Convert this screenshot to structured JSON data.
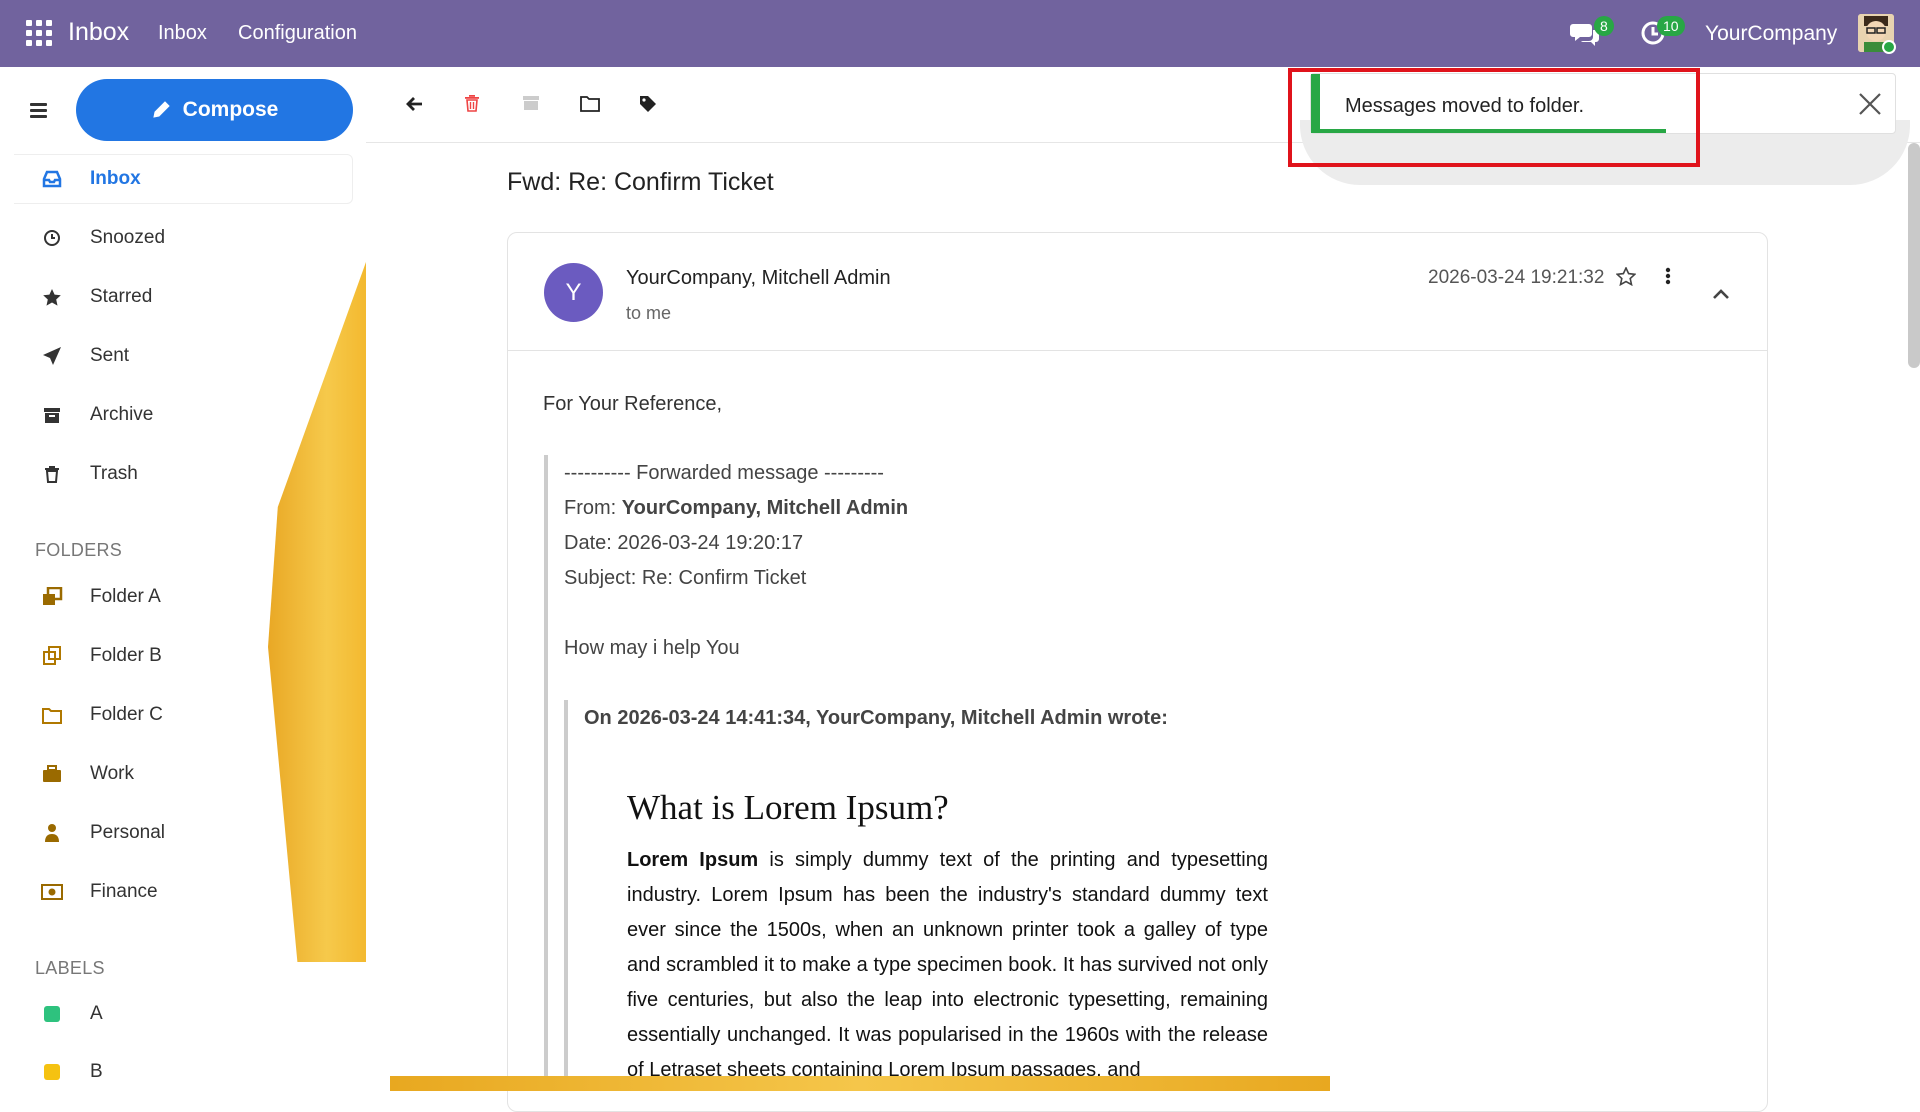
{
  "topbar": {
    "app_title": "Inbox",
    "nav": [
      "Inbox",
      "Configuration"
    ],
    "messages_count": "8",
    "activities_count": "10",
    "company": "YourCompany"
  },
  "sidebar": {
    "compose_label": "Compose",
    "items": [
      {
        "label": "Inbox",
        "icon": "inbox-icon"
      },
      {
        "label": "Snoozed",
        "icon": "clock-icon"
      },
      {
        "label": "Starred",
        "icon": "star-icon"
      },
      {
        "label": "Sent",
        "icon": "paper-plane-icon"
      },
      {
        "label": "Archive",
        "icon": "archive-icon"
      },
      {
        "label": "Trash",
        "icon": "trash-icon"
      }
    ],
    "folders_heading": "FOLDERS",
    "folders": [
      {
        "label": "Folder A",
        "icon": "folder-a-icon"
      },
      {
        "label": "Folder B",
        "icon": "folder-b-icon"
      },
      {
        "label": "Folder C",
        "icon": "folder-outline-icon"
      },
      {
        "label": "Work",
        "icon": "briefcase-icon"
      },
      {
        "label": "Personal",
        "icon": "person-icon"
      },
      {
        "label": "Finance",
        "icon": "money-icon"
      }
    ],
    "labels_heading": "LABELS",
    "labels": [
      {
        "label": "A",
        "color": "#2ec27e"
      },
      {
        "label": "B",
        "color": "#f5c211"
      }
    ]
  },
  "toast": {
    "message": "Messages moved to folder."
  },
  "email": {
    "subject": "Fwd: Re: Confirm Ticket",
    "avatar_letter": "Y",
    "sender": "YourCompany, Mitchell Admin",
    "to": "to me",
    "date": "2026-03-24 19:21:32",
    "greeting": "For Your Reference,",
    "fwd_header": "---------- Forwarded message ---------",
    "from_label": "From: ",
    "from_value": "YourCompany, Mitchell Admin",
    "date_line": "Date: 2026-03-24 19:20:17",
    "subject_line": "Subject: Re: Confirm Ticket",
    "help_line": "How may i help You",
    "wrote_line": "On 2026-03-24 14:41:34, YourCompany, Mitchell Admin wrote:",
    "lorem_heading": "What is Lorem Ipsum?",
    "lorem_bold": "Lorem Ipsum",
    "lorem_body": " is simply dummy text of the printing and typesetting industry. Lorem Ipsum has been the industry's standard dummy text ever since the 1500s, when an unknown printer took a galley of type and scrambled it to make a type specimen book. It has survived not only five centuries, but also the leap into electronic typesetting, remaining essentially unchanged. It was popularised in the 1960s with the release of Letraset sheets containing Lorem Ipsum passages, and"
  }
}
